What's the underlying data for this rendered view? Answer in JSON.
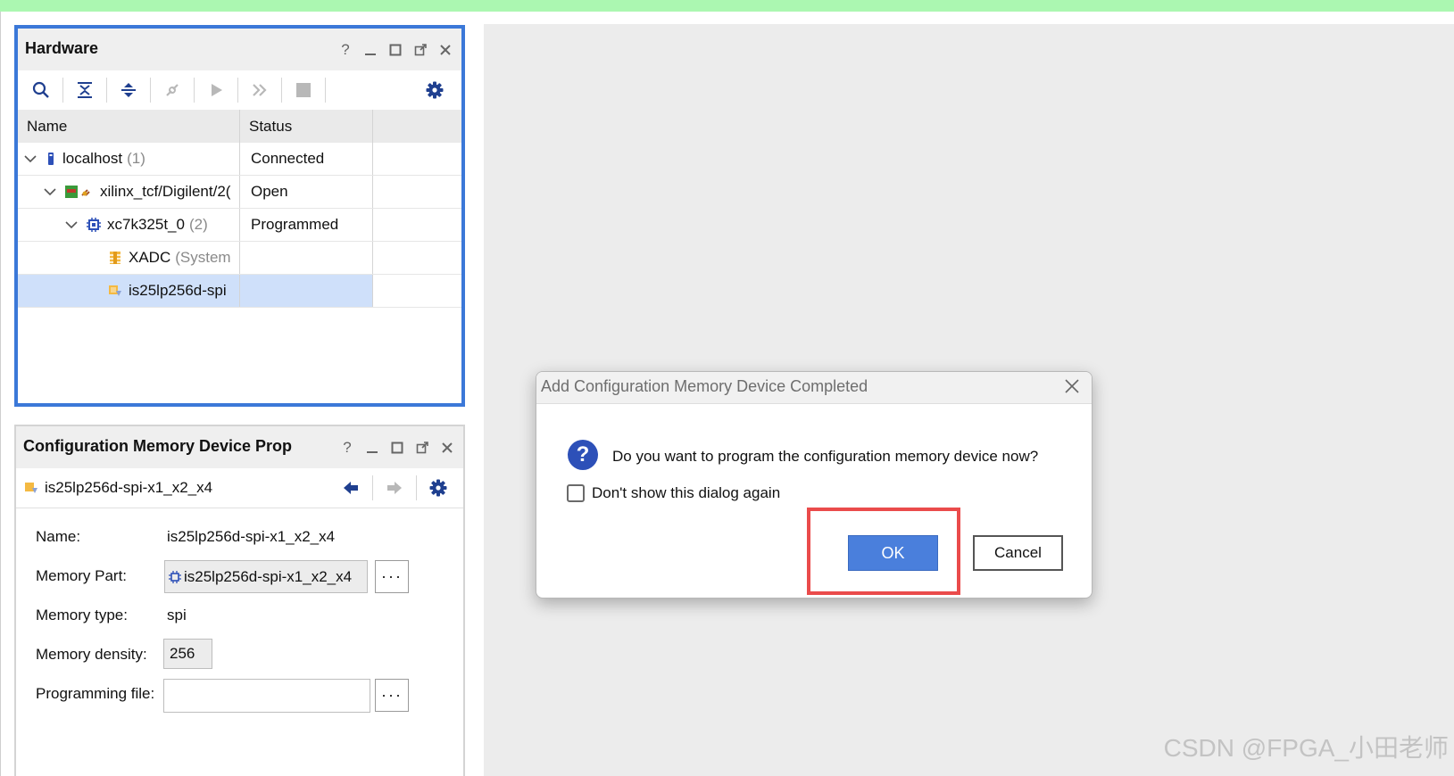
{
  "hardware": {
    "title": "Hardware",
    "controls": {
      "help": "?"
    },
    "columns": {
      "name": "Name",
      "status": "Status"
    },
    "tree": [
      {
        "name": "localhost",
        "count": "(1)",
        "status": "Connected",
        "icon": "server-icon"
      },
      {
        "name": "xilinx_tcf/Digilent/2(",
        "count": "",
        "status": "Open",
        "icon": "board-icon"
      },
      {
        "name": "xc7k325t_0",
        "count": "(2)",
        "status": "Programmed",
        "icon": "chip-icon"
      },
      {
        "name": "XADC",
        "count": "(System",
        "status": "",
        "icon": "xadc-icon"
      },
      {
        "name": "is25lp256d-spi",
        "count": "",
        "status": "",
        "icon": "memory-device-icon"
      }
    ]
  },
  "properties": {
    "title": "Configuration Memory Device Prop",
    "device": "is25lp256d-spi-x1_x2_x4",
    "fields": {
      "name_label": "Name:",
      "name_value": "is25lp256d-spi-x1_x2_x4",
      "part_label": "Memory Part:",
      "part_value": "is25lp256d-spi-x1_x2_x4",
      "type_label": "Memory type:",
      "type_value": "spi",
      "density_label": "Memory density:",
      "density_value": "256",
      "file_label": "Programming file:",
      "file_value": ""
    },
    "ellipsis": "···"
  },
  "dialog": {
    "title": "Add Configuration Memory Device Completed",
    "message": "Do you want to program the configuration memory device now?",
    "checkbox_label": "Don't show this dialog again",
    "ok": "OK",
    "cancel": "Cancel",
    "icon": "?"
  },
  "watermark": "CSDN @FPGA_小田老师",
  "colors": {
    "accent": "#3b78d8",
    "ok_button": "#4a7fdc",
    "highlight": "#ea4b4b",
    "top_bar": "#abf7b1"
  }
}
